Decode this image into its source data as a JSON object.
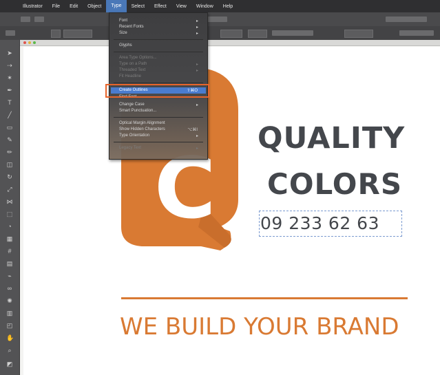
{
  "menubar": {
    "items": [
      "Illustrator",
      "File",
      "Edit",
      "Object",
      "Type",
      "Select",
      "Effect",
      "View",
      "Window",
      "Help"
    ],
    "active": "Type"
  },
  "type_menu": {
    "items": [
      {
        "label": "Font",
        "disabled": false,
        "submenu": true
      },
      {
        "label": "Recent Fonts",
        "disabled": false,
        "submenu": true
      },
      {
        "label": "Size",
        "disabled": false,
        "submenu": true
      },
      {
        "label": "Glyphs",
        "disabled": false,
        "submenu": false
      },
      {
        "label": "Area Type Options...",
        "disabled": true,
        "submenu": false
      },
      {
        "label": "Type on a Path",
        "disabled": true,
        "submenu": true
      },
      {
        "label": "Threaded Text",
        "disabled": true,
        "submenu": true
      },
      {
        "label": "Fit Headline",
        "disabled": true,
        "submenu": false
      },
      {
        "label": "Create Outlines",
        "disabled": false,
        "submenu": false,
        "shortcut": "⇧⌘O",
        "highlighted": true
      },
      {
        "label": "Find Font...",
        "disabled": false,
        "submenu": false
      },
      {
        "label": "Change Case",
        "disabled": false,
        "submenu": true
      },
      {
        "label": "Smart Punctuation...",
        "disabled": false,
        "submenu": false
      },
      {
        "label": "Optical Margin Alignment",
        "disabled": false,
        "submenu": false
      },
      {
        "label": "Show Hidden Characters",
        "disabled": false,
        "submenu": false,
        "shortcut": "⌥⌘I"
      },
      {
        "label": "Type Orientation",
        "disabled": false,
        "submenu": true
      },
      {
        "label": "Legacy Text",
        "disabled": true,
        "submenu": true
      }
    ]
  },
  "document": {
    "logo_letter": "C",
    "headline_line1": "QUALITY",
    "headline_line2": "COLORS",
    "phone": "09 233 62 63",
    "tagline": "WE BUILD YOUR BRAND"
  },
  "colors": {
    "brand_orange": "#d97a33",
    "headline_gray": "#44474c",
    "menu_highlight": "#4a7ccf",
    "annotation": "#e8642a"
  }
}
